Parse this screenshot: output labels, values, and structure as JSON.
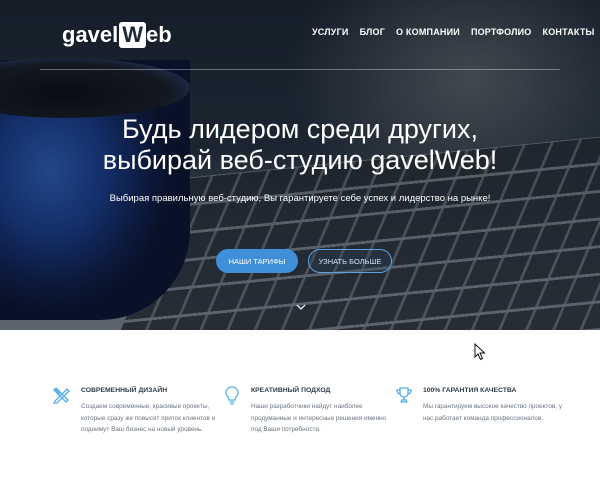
{
  "brand": {
    "logo_text": "gavel",
    "logo_highlight": "W",
    "logo_suffix": "eb"
  },
  "nav": {
    "items": [
      "УСЛУГИ",
      "БЛОГ",
      "О КОМПАНИИ",
      "ПОРТФОЛИО",
      "КОНТАКТЫ"
    ]
  },
  "hero": {
    "title_line1": "Будь лидером среди других,",
    "title_line2": "выбирай веб-студию gavelWeb!",
    "subtitle": "Выбирая правильную веб-студию, Вы гарантируете себе успех и лидерство на рынке!",
    "primary_button": "НАШИ ТАРИФЫ",
    "secondary_button": "УЗНАТЬ БОЛЬШЕ"
  },
  "features": [
    {
      "icon": "pencil-ruler-icon",
      "title": "СОВРЕМЕННЫЙ ДИЗАЙН",
      "desc": "Создаем современные, красивые проекты, которые сразу же повысят приток клиентов и поднимут Ваш бизнес на новый уровень."
    },
    {
      "icon": "lightbulb-icon",
      "title": "КРЕАТИВНЫЙ ПОДХОД",
      "desc": "Наши разработчики найдут наиболее продуманные и интересные решения именно под Ваши потребности."
    },
    {
      "icon": "trophy-icon",
      "title": "100% ГАРАНТИЯ КАЧЕСТВА",
      "desc": "Мы гарантируем высокое качество проектов, у нас работает команда профессионалов."
    }
  ],
  "colors": {
    "accent": "#3f8fd9",
    "icon": "#56aee8",
    "text_dark": "#2f3b48",
    "text_muted": "#6b7580"
  }
}
